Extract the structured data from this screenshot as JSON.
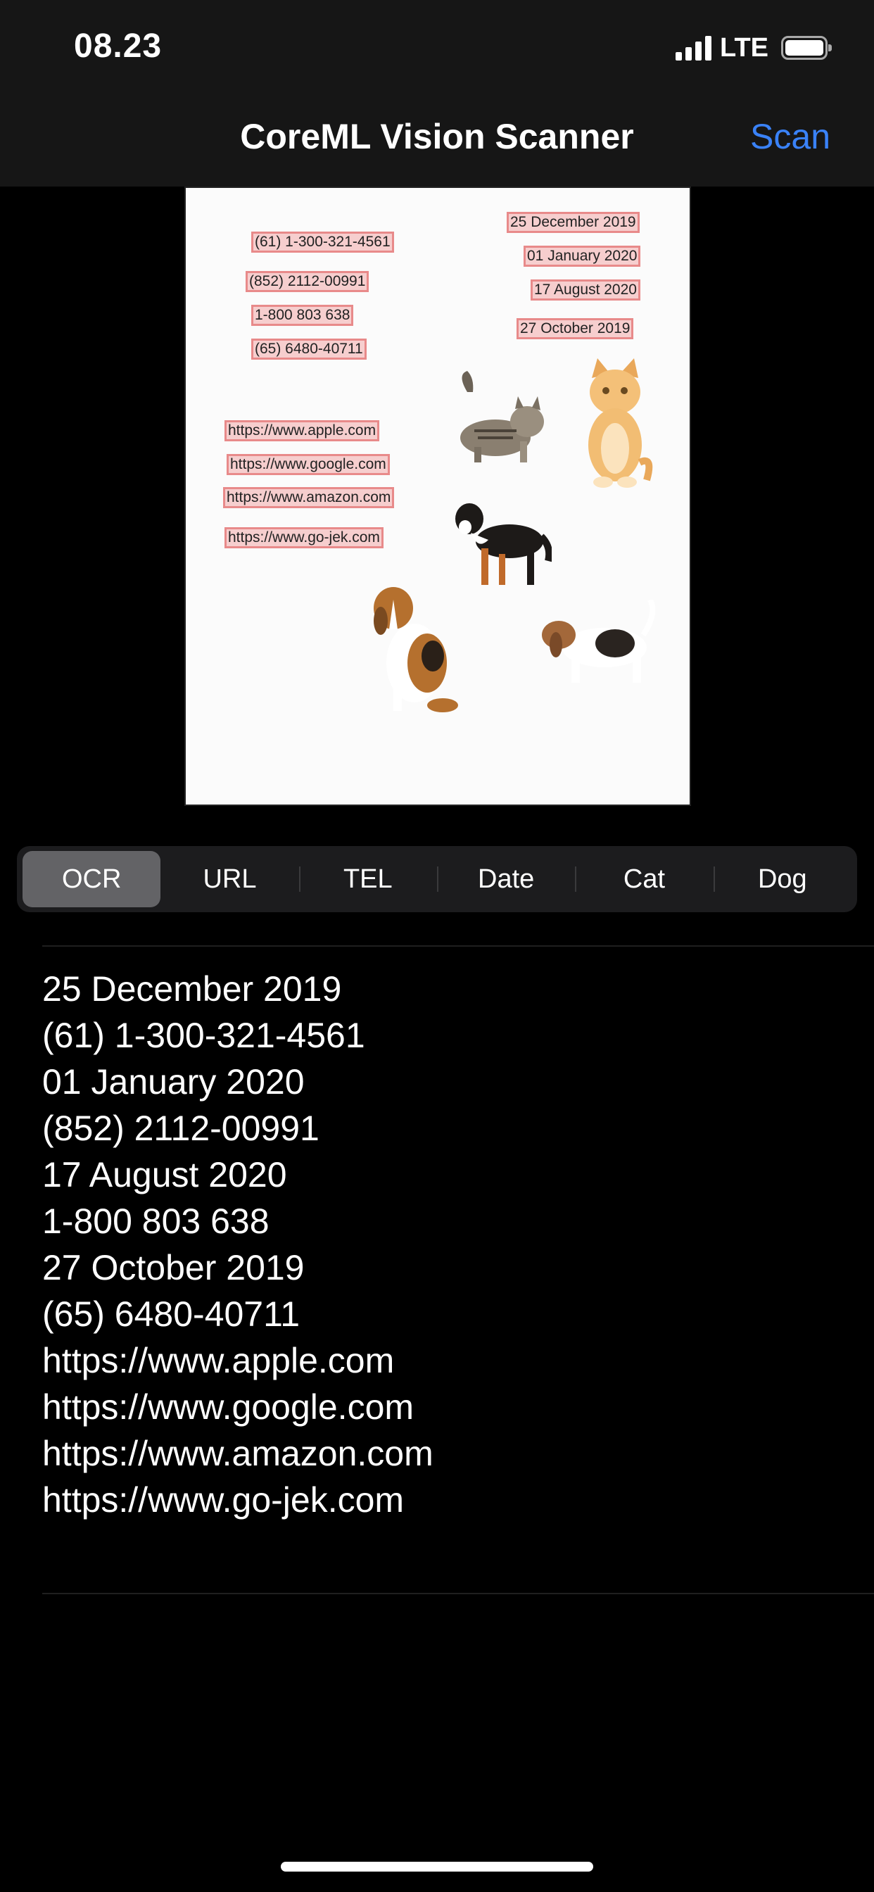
{
  "status": {
    "time": "08.23",
    "network": "LTE"
  },
  "nav": {
    "title": "CoreML Vision Scanner",
    "scan_label": "Scan"
  },
  "document": {
    "detections": [
      "25 December 2019",
      "(61) 1-300-321-4561",
      "01 January 2020",
      "(852) 2112-00991",
      "17 August 2020",
      "1-800 803 638",
      "27 October  2019",
      "(65) 6480-40711",
      "https://www.apple.com",
      "https://www.google.com",
      "https://www.amazon.com",
      "https://www.go-jek.com"
    ]
  },
  "segments": [
    {
      "label": "OCR",
      "selected": true
    },
    {
      "label": "URL",
      "selected": false
    },
    {
      "label": "TEL",
      "selected": false
    },
    {
      "label": "Date",
      "selected": false
    },
    {
      "label": "Cat",
      "selected": false
    },
    {
      "label": "Dog",
      "selected": false
    }
  ],
  "ocr_results": [
    "25 December 2019",
    "(61) 1-300-321-4561",
    "01 January 2020",
    "(852) 2112-00991",
    "17 August 2020",
    "1-800 803 638",
    "27 October 2019",
    "(65) 6480-40711",
    "https://www.apple.com",
    "https://www.google.com",
    "https://www.amazon.com",
    "https://www.go-jek.com"
  ],
  "colors": {
    "accent": "#3a82f7",
    "highlight": "#e88a8a",
    "segment_selected": "#636366"
  }
}
